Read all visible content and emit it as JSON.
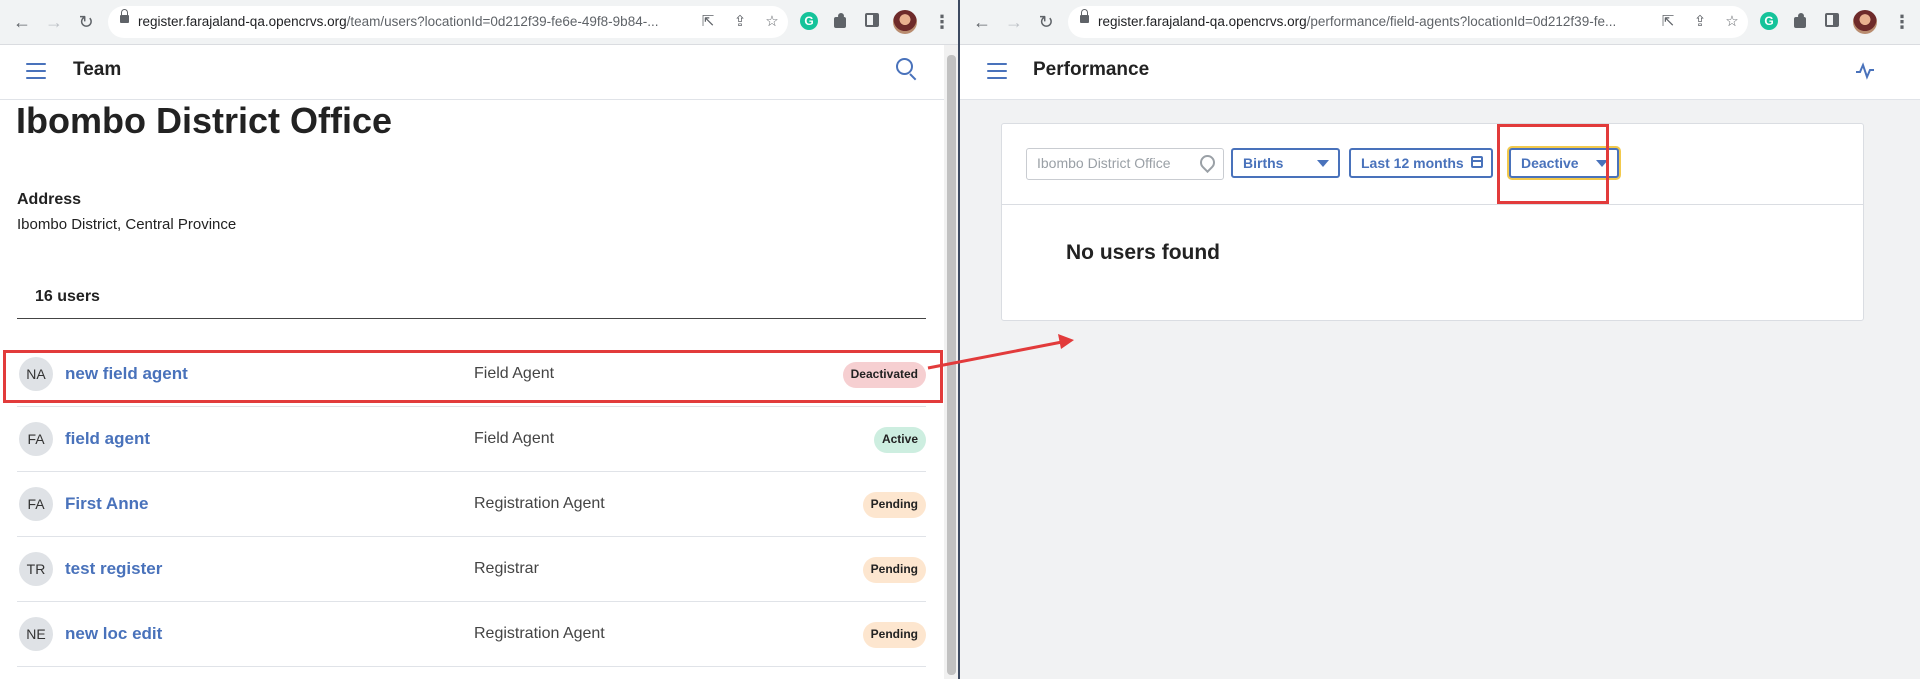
{
  "left_window": {
    "url_main": "register.farajaland-qa.opencrvs.org",
    "url_rest": "/team/users?locationId=0d212f39-fe6e-49f8-9b84-...",
    "app_title": "Team",
    "office_title": "Ibombo District Office",
    "address_label": "Address",
    "address_value": "Ibombo District, Central Province",
    "users_count": "16 users",
    "users": [
      {
        "initials": "NA",
        "name": "new field agent",
        "role": "Field Agent",
        "status": "Deactivated",
        "status_color": "#f6cfd1"
      },
      {
        "initials": "FA",
        "name": "field agent",
        "role": "Field Agent",
        "status": "Active",
        "status_color": "#cdeee0"
      },
      {
        "initials": "FA",
        "name": "First Anne",
        "role": "Registration Agent",
        "status": "Pending",
        "status_color": "#fde6cf"
      },
      {
        "initials": "TR",
        "name": "test register",
        "role": "Registrar",
        "status": "Pending",
        "status_color": "#fde6cf"
      },
      {
        "initials": "NE",
        "name": "new loc edit",
        "role": "Registration Agent",
        "status": "Pending",
        "status_color": "#fde6cf"
      }
    ]
  },
  "right_window": {
    "url_main": "register.farajaland-qa.opencrvs.org",
    "url_rest": "/performance/field-agents?locationId=0d212f39-fe...",
    "app_title": "Performance",
    "filters": {
      "location_placeholder": "Ibombo District Office",
      "event": "Births",
      "period": "Last 12 months",
      "status": "Deactive"
    },
    "empty_message": "No users found"
  },
  "colors": {
    "accent": "#4972bb",
    "highlight": "#e23b3b",
    "focus": "#f2c94c"
  }
}
